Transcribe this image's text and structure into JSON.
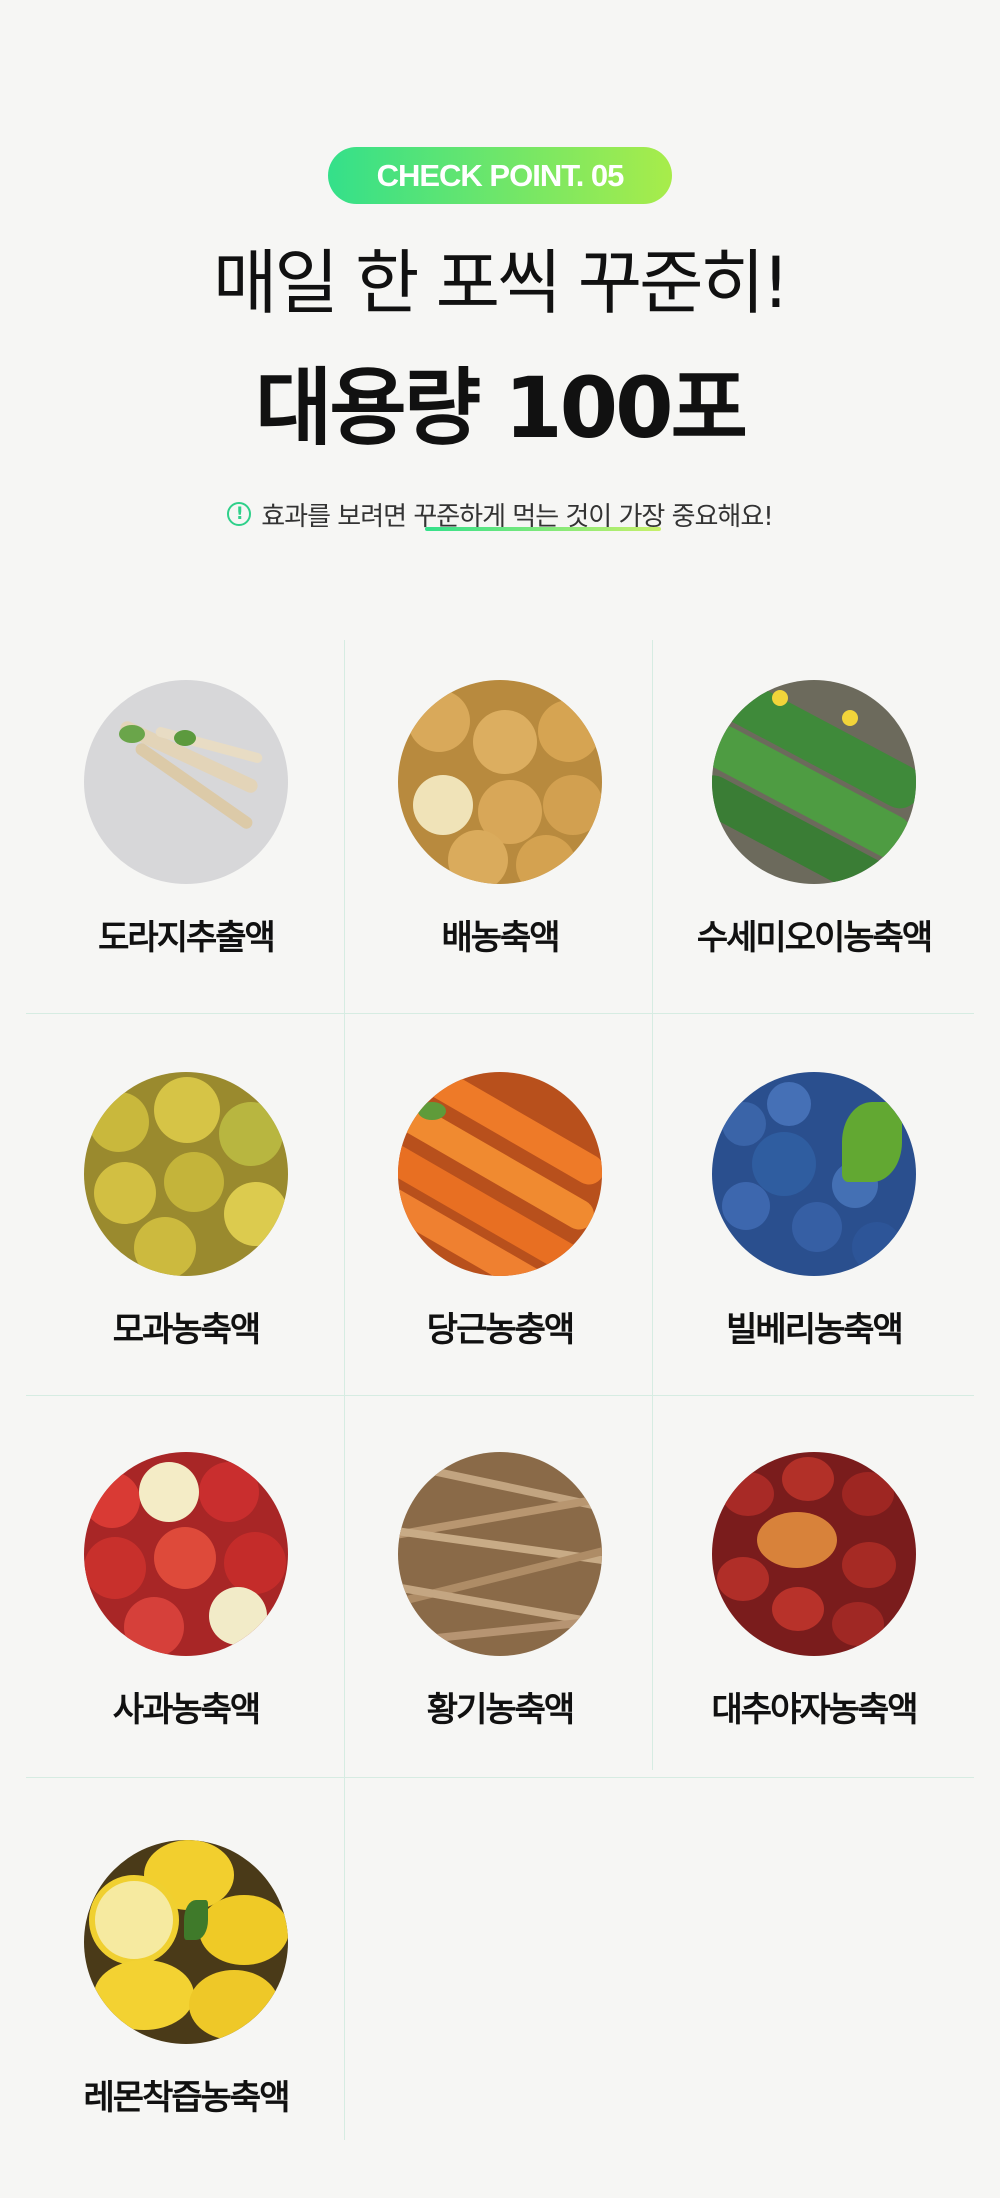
{
  "badge": "CHECK POINT.  05",
  "headline": "매일 한 포씩 꾸준히!",
  "subheadline": "대용량 100포",
  "note": {
    "icon": "exclamation-circle-icon",
    "text": "효과를 보려면 꾸준하게 먹는 것이 가장 중요해요!"
  },
  "items": [
    {
      "label": "도라지추출액",
      "icon": "bellflower-root"
    },
    {
      "label": "배농축액",
      "icon": "pear"
    },
    {
      "label": "수세미오이농축액",
      "icon": "luffa-cucumber"
    },
    {
      "label": "모과농축액",
      "icon": "quince"
    },
    {
      "label": "당근농충액",
      "icon": "carrot"
    },
    {
      "label": "빌베리농축액",
      "icon": "bilberry"
    },
    {
      "label": "사과농축액",
      "icon": "apple"
    },
    {
      "label": "황기농축액",
      "icon": "astragalus-root"
    },
    {
      "label": "대추야자농축액",
      "icon": "date-palm"
    },
    {
      "label": "레몬착즙농축액",
      "icon": "lemon"
    }
  ],
  "colors": {
    "accent_start": "#34e08a",
    "accent_end": "#a8ec4a",
    "background": "#f6f6f4",
    "grid_line": "#d6ece2"
  }
}
